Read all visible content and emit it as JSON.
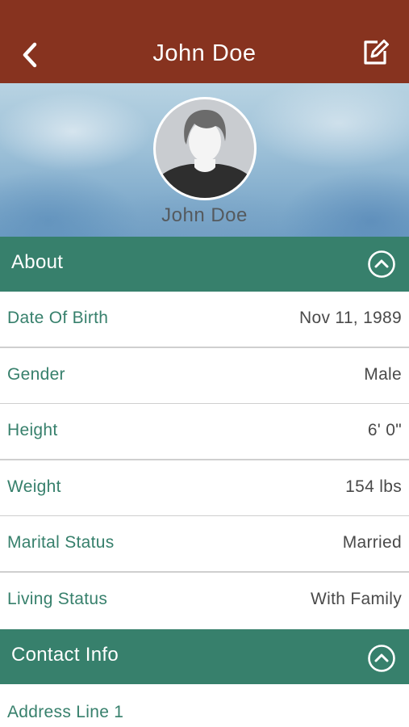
{
  "header": {
    "title": "John Doe",
    "back_icon": "chevron-left-icon",
    "edit_icon": "edit-icon",
    "background_color": "#87331f"
  },
  "profile": {
    "name": "John Doe",
    "avatar_icon": "user-avatar-icon"
  },
  "about": {
    "title": "About",
    "toggle_icon": "chevron-up-circle-icon",
    "color": "#37806c",
    "rows": [
      {
        "label": "Date Of Birth",
        "value": "Nov 11, 1989"
      },
      {
        "label": "Gender",
        "value": "Male"
      },
      {
        "label": "Height",
        "value": "6' 0\""
      },
      {
        "label": "Weight",
        "value": "154 lbs"
      },
      {
        "label": "Marital Status",
        "value": "Married"
      },
      {
        "label": "Living Status",
        "value": "With Family"
      }
    ]
  },
  "contact": {
    "title": "Contact Info",
    "toggle_icon": "chevron-up-circle-icon",
    "rows": [
      {
        "label": "Address Line 1",
        "value": ""
      }
    ]
  }
}
